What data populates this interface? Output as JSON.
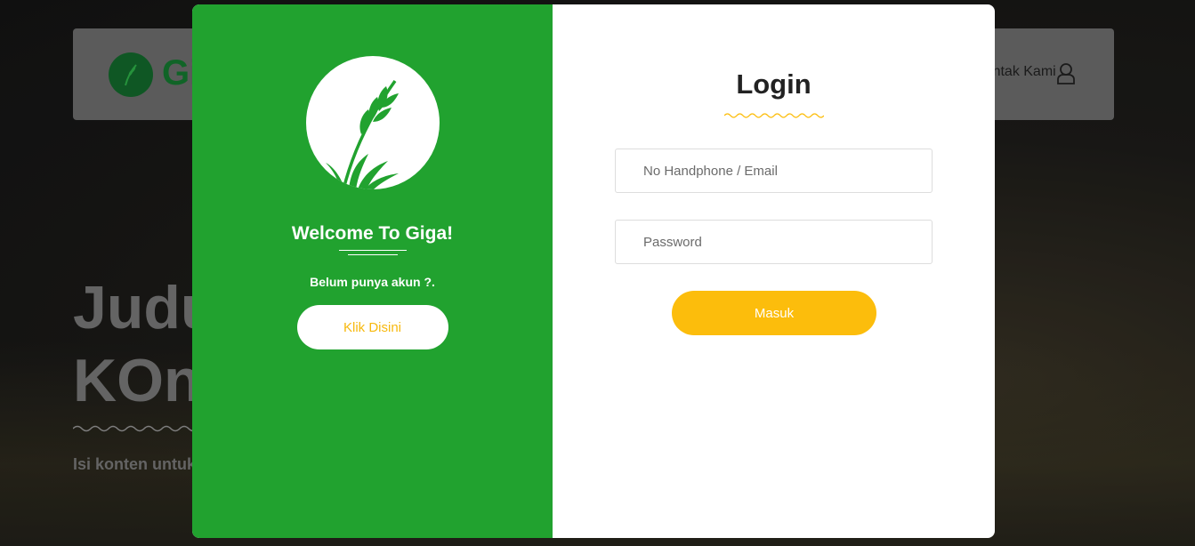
{
  "background": {
    "brand": "Giga",
    "nav_link": "Kontak Kami",
    "hero_title_line1": "Judul",
    "hero_title_line2": "KOnten",
    "hero_subtitle": "Isi konten untuk"
  },
  "modal": {
    "left": {
      "welcome": "Welcome To Giga!",
      "signup_prompt": "Belum punya akun ?.",
      "signup_button": "Klik Disini"
    },
    "right": {
      "title": "Login",
      "email_placeholder": "No Handphone / Email",
      "password_placeholder": "Password",
      "submit_button": "Masuk"
    }
  },
  "colors": {
    "primary_green": "#21a22f",
    "accent_yellow": "#fcbd0c",
    "dark_green": "#136b2c"
  },
  "icons": [
    "wheat-icon",
    "close-icon",
    "user-icon"
  ]
}
